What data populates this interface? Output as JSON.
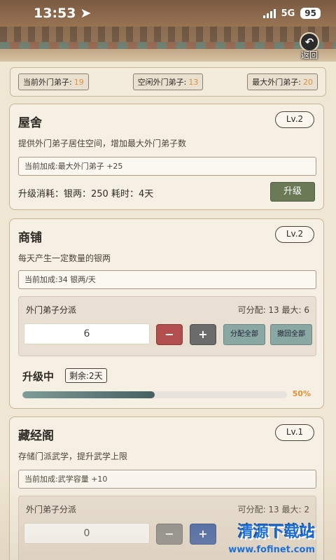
{
  "status_bar": {
    "time": "13:53",
    "network": "5G",
    "battery": "95"
  },
  "header": {
    "back_label": "返回",
    "back_icon": "back-arrow-icon"
  },
  "stats": [
    {
      "label": "当前外门弟子:",
      "value": "19"
    },
    {
      "label": "空闲外门弟子:",
      "value": "13"
    },
    {
      "label": "最大外门弟子:",
      "value": "20"
    }
  ],
  "buildings": {
    "house": {
      "title": "屋舍",
      "level": "Lv.2",
      "desc": "提供外门弟子居住空间，增加最大外门弟子数",
      "bonus": "当前加成:最大外门弟子 +25",
      "cost": "升级消耗：银两：250 耗时：4天",
      "upgrade_label": "升级"
    },
    "shop": {
      "title": "商铺",
      "level": "Lv.2",
      "desc": "每天产生一定数量的银两",
      "bonus": "当前加成:34 银两/天",
      "assign_title": "外门弟子分派",
      "assign_info": "可分配: 13 最大: 6",
      "assign_value": "6",
      "minus": "−",
      "plus": "+",
      "assign_all": "分配全部",
      "recall_all": "撤回全部",
      "upgrading_label": "升级中",
      "remain": "剩余:2天",
      "progress": 0.5,
      "progress_text": "50%"
    },
    "library": {
      "title": "藏经阁",
      "level": "Lv.1",
      "desc": "存储门派武学，提升武学上限",
      "bonus": "当前加成:武学容量 +10",
      "assign_title": "外门弟子分派",
      "assign_info": "可分配: 13 最大: 2",
      "assign_value": "0",
      "minus": "−",
      "plus": "+"
    }
  },
  "watermark": {
    "text": "清源下载站",
    "url": "www.fofinet.com"
  }
}
